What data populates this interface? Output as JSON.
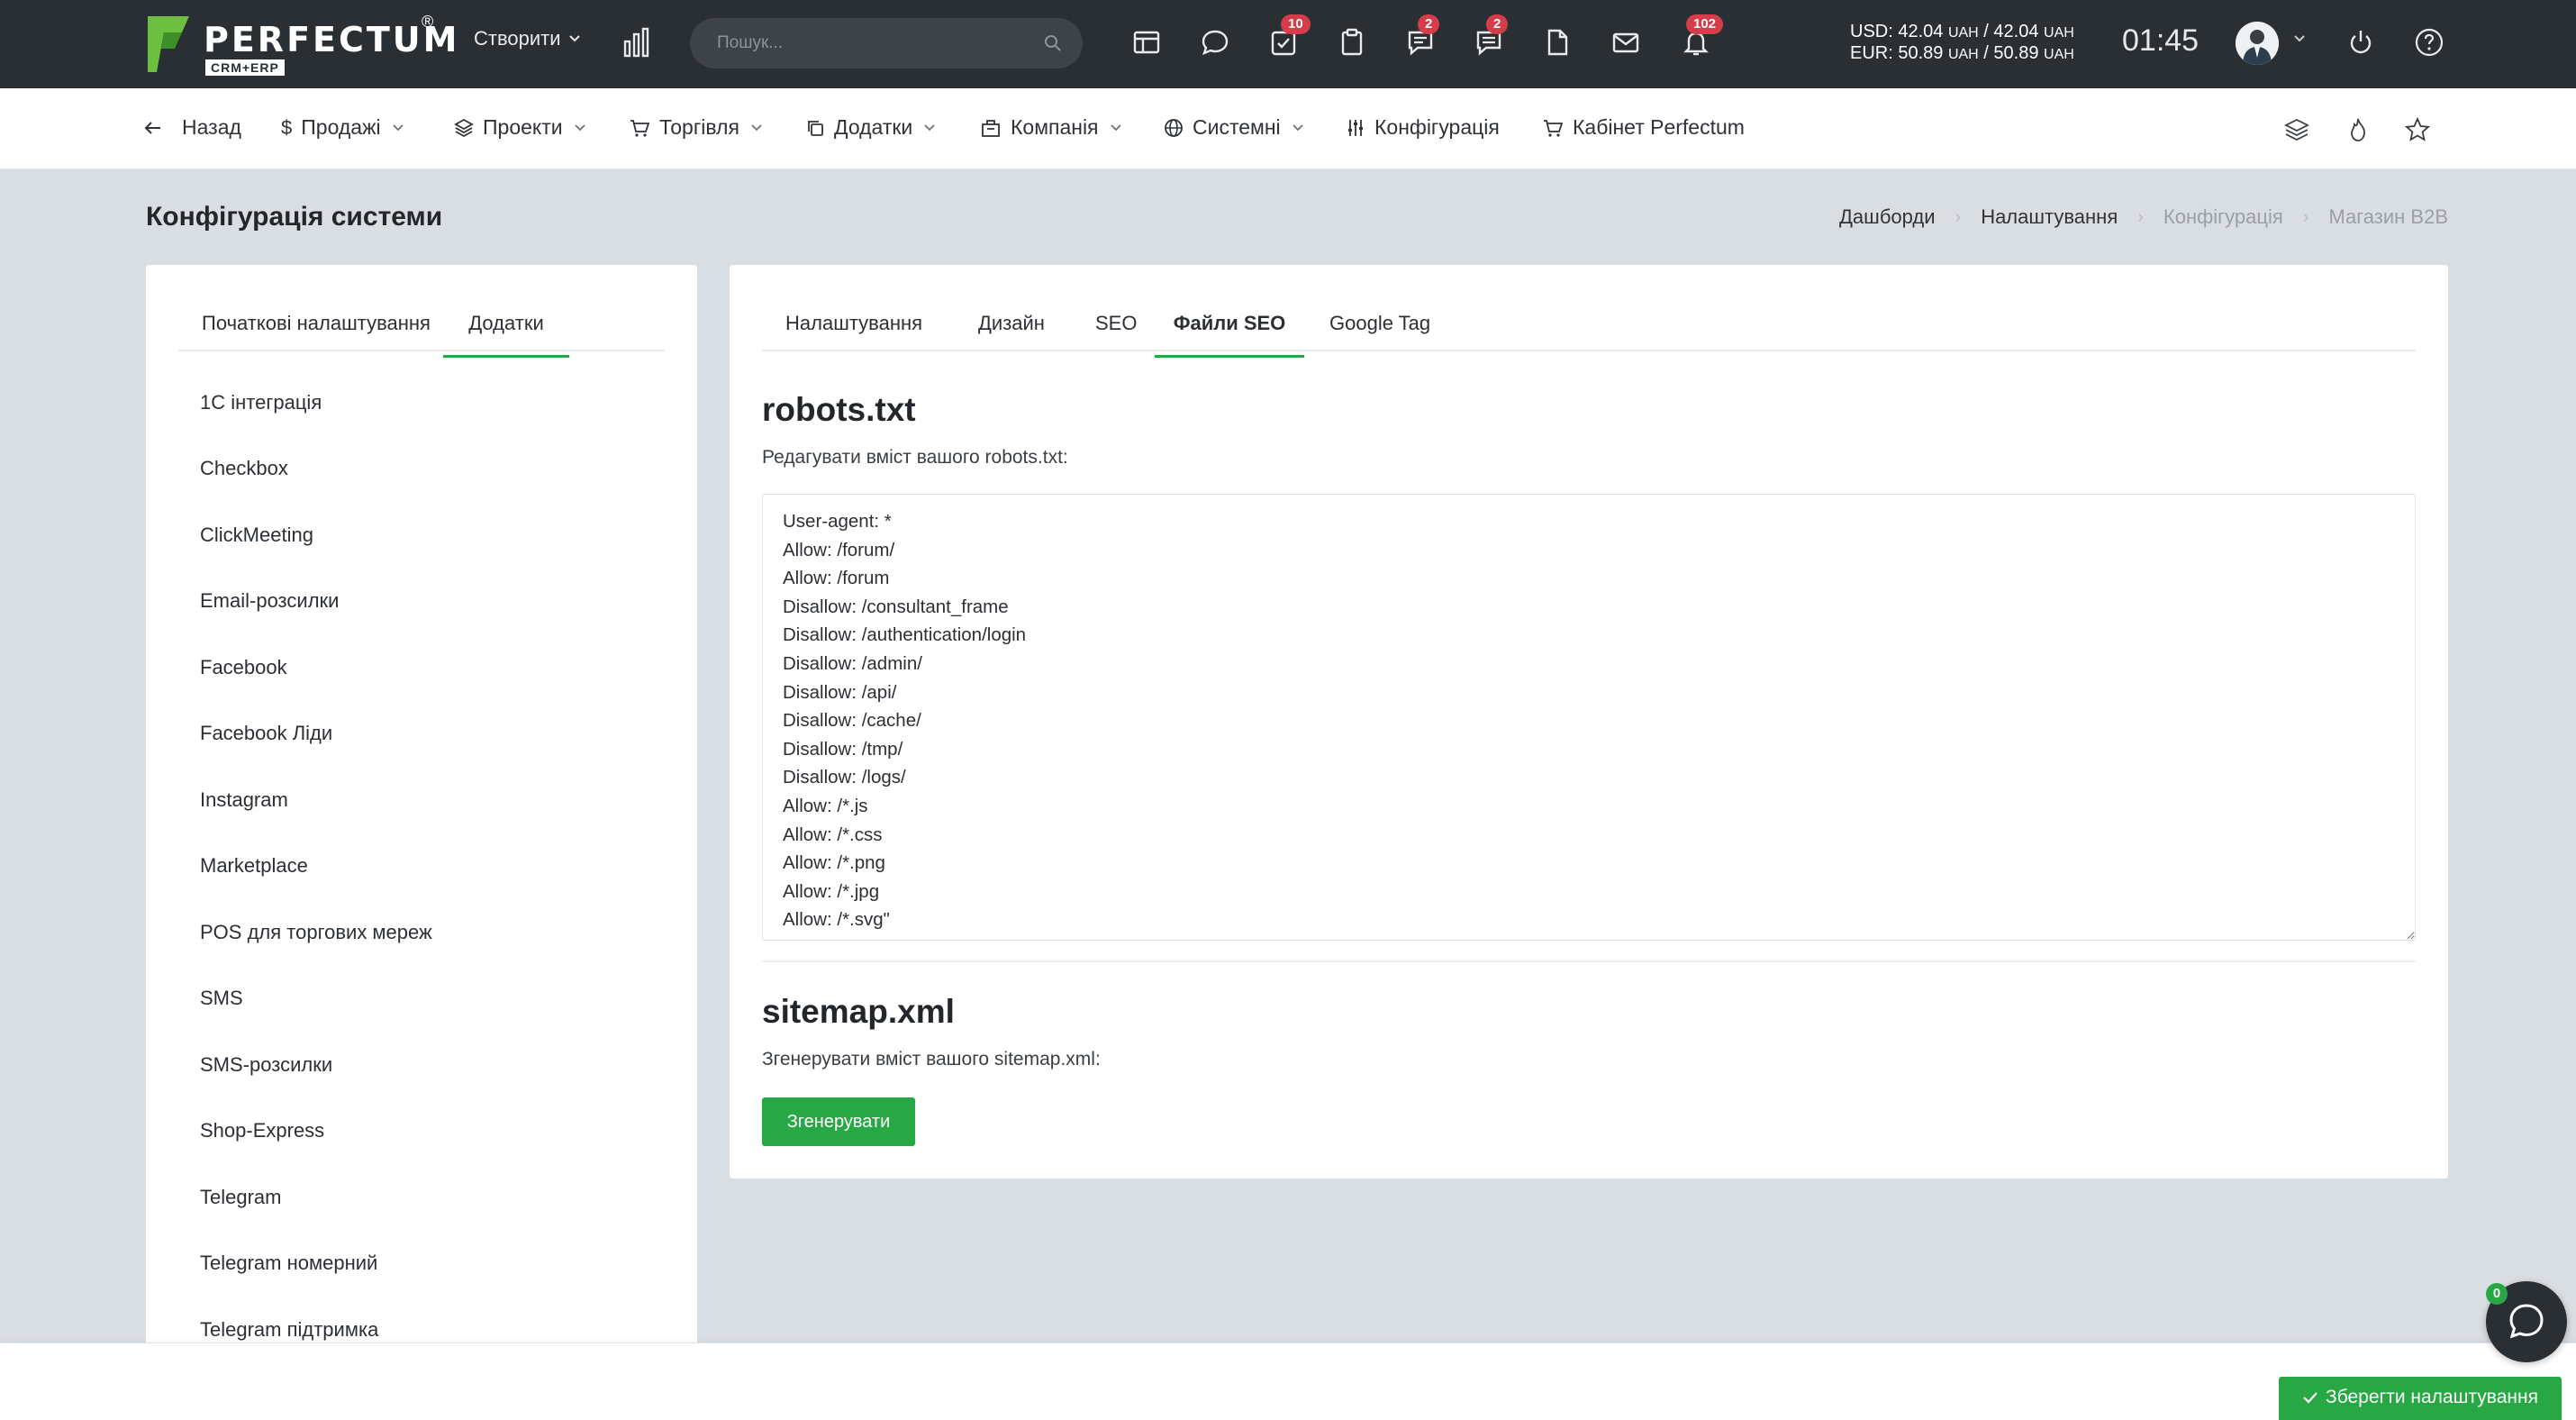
{
  "header": {
    "logo_text": "PERFECTUM",
    "logo_sub": "CRM+ERP",
    "create_label": "Створити",
    "search_placeholder": "Пошук...",
    "badges": {
      "tasks": "10",
      "chats": "2",
      "comments": "2",
      "notifications": "102"
    },
    "rates": {
      "usd_label": "USD: 42.04",
      "usd_unit1": "UAH",
      "usd_mid": " / 42.04",
      "usd_unit2": "UAH",
      "eur_label": "EUR: 50.89",
      "eur_unit1": "UAH",
      "eur_mid": " / 50.89",
      "eur_unit2": "UAH"
    },
    "time": "01:45"
  },
  "nav": {
    "back": "Назад",
    "sales": "Продажі",
    "projects": "Проекти",
    "trade": "Торгівля",
    "addons": "Додатки",
    "company": "Компанія",
    "system": "Системні",
    "config": "Конфігурація",
    "cabinet": "Кабінет Perfectum"
  },
  "page": {
    "title": "Конфігурація системи",
    "breadcrumb": [
      "Дашборди",
      "Налаштування",
      "Конфігурація",
      "Магазин B2B"
    ]
  },
  "left": {
    "tabs": [
      "Початкові налаштування",
      "Додатки"
    ],
    "items": [
      "1С інтеграція",
      "Checkbox",
      "ClickMeeting",
      "Email-розсилки",
      "Facebook",
      "Facebook Ліди",
      "Instagram",
      "Marketplace",
      "POS для торгових мереж",
      "SMS",
      "SMS-розсилки",
      "Shop-Express",
      "Telegram",
      "Telegram номерний",
      "Telegram підтримка"
    ]
  },
  "right": {
    "tabs": [
      "Налаштування",
      "Дизайн",
      "SEO",
      "Файли SEO",
      "Google Tag"
    ],
    "robots_title": "robots.txt",
    "robots_desc": "Редагувати вміст вашого robots.txt:",
    "robots_content": "User-agent: *\nAllow: /forum/\nAllow: /forum\nDisallow: /consultant_frame\nDisallow: /authentication/login\nDisallow: /admin/\nDisallow: /api/\nDisallow: /cache/\nDisallow: /tmp/\nDisallow: /logs/\nAllow: /*.js\nAllow: /*.css\nAllow: /*.png\nAllow: /*.jpg\nAllow: /*.svg\"",
    "sitemap_title": "sitemap.xml",
    "sitemap_desc": "Згенерувати вміст вашого sitemap.xml:",
    "generate_label": "Згенерувати"
  },
  "footer": {
    "save_label": "Зберегти налаштування",
    "chat_count": "0"
  },
  "colors": {
    "accent": "#28a745",
    "header_bg": "#2a2f33",
    "page_bg": "#d9dee2",
    "badge": "#d63d4a"
  }
}
